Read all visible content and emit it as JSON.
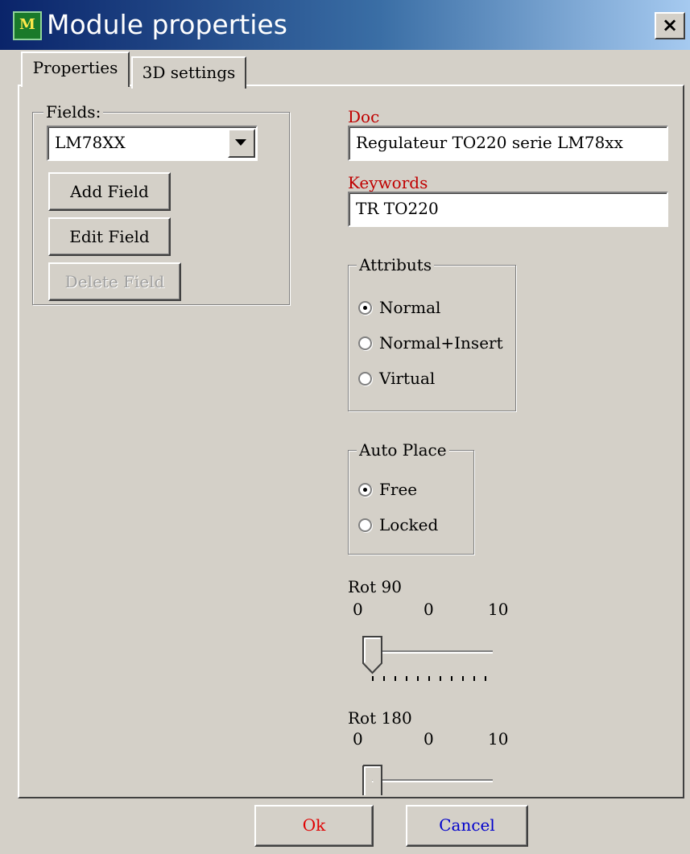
{
  "window": {
    "title": "Module properties",
    "close_glyph": "×",
    "icon_glyph": "M",
    "icon": "app-module-icon"
  },
  "tabs": [
    {
      "label": "Properties"
    },
    {
      "label": "3D settings"
    }
  ],
  "fields_group": {
    "label": "Fields:",
    "selected": "LM78XX",
    "buttons": {
      "add": "Add Field",
      "edit": "Edit Field",
      "delete": "Delete Field"
    }
  },
  "doc": {
    "label": "Doc",
    "value": "Regulateur TO220 serie LM78xx"
  },
  "keywords": {
    "label": "Keywords",
    "value": "TR TO220"
  },
  "attributs": {
    "label": "Attributs",
    "options": [
      "Normal",
      "Normal+Insert",
      "Virtual"
    ],
    "selected": "Normal"
  },
  "auto_place": {
    "label": "Auto Place",
    "options": [
      "Free",
      "Locked"
    ],
    "selected": "Free"
  },
  "rot90": {
    "label": "Rot 90",
    "min": "0",
    "value": "0",
    "max": "10"
  },
  "rot180": {
    "label": "Rot 180",
    "min": "0",
    "value": "0",
    "max": "10"
  },
  "footer": {
    "ok": "Ok",
    "cancel": "Cancel"
  },
  "colors": {
    "label_red": "#c00000",
    "ok_text": "#e00000",
    "cancel_text": "#0000cc"
  }
}
